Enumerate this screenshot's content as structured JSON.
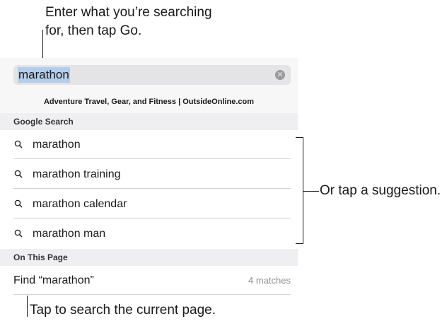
{
  "callouts": {
    "top_line1": "Enter what you’re searching",
    "top_line2": "for, then tap Go.",
    "right": "Or tap a suggestion.",
    "bottom": "Tap to search the current page."
  },
  "search": {
    "value": "marathon",
    "clear_icon": "clear-x-circle-icon"
  },
  "top_hit": "Adventure Travel, Gear, and Fitness | OutsideOnline.com",
  "google_section": {
    "header": "Google Search",
    "suggestions": [
      {
        "label": "marathon",
        "icon": "magnifier-icon"
      },
      {
        "label": "marathon training",
        "icon": "magnifier-icon"
      },
      {
        "label": "marathon calendar",
        "icon": "magnifier-icon"
      },
      {
        "label": "marathon man",
        "icon": "magnifier-icon"
      }
    ]
  },
  "page_section": {
    "header": "On This Page",
    "find_label": "Find “marathon”",
    "matches": "4 matches"
  }
}
